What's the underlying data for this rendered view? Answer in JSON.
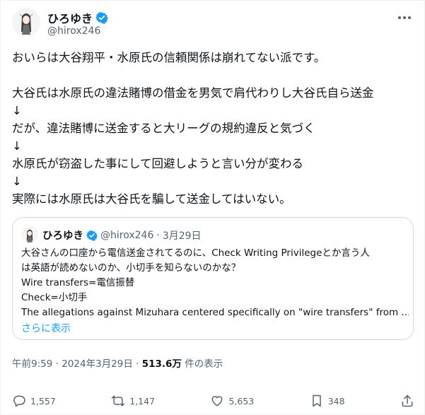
{
  "author": {
    "name": "ひろゆき",
    "handle": "@hirox246"
  },
  "tweet": {
    "lines": [
      "おいらは大谷翔平・水原氏の信頼関係は崩れてない派です。",
      "",
      "大谷氏は水原氏の違法賭博の借金を男気で肩代わりし大谷氏自ら送金",
      "↓",
      "だが、違法賭博に送金すると大リーグの規約違反と気づく",
      "↓",
      "水原氏が窃盗した事にして回避しようと言い分が変わる",
      "↓",
      "実際には水原氏は大谷氏を騙して送金してはいない。"
    ]
  },
  "quote": {
    "name": "ひろゆき",
    "handle": "@hirox246",
    "separator": "·",
    "date": "3月29日",
    "lines": [
      "大谷さんの口座から電信送金されてるのに、Check Writing Privilegeとか言う人",
      "は英語が読めないのか、小切手を知らないのかな？",
      "Wire transfers=電信振替",
      "Check=小切手",
      "The allegations against Mizuhara centered specifically on \"wire transfers\" from ..."
    ],
    "show_more": "さらに表示"
  },
  "meta": {
    "time": "午前9:59",
    "sep1": "·",
    "date": "2024年3月29日",
    "sep2": "·",
    "views": "513.6万",
    "views_label": "件の表示"
  },
  "actions": {
    "replies": "1,557",
    "reposts": "1,147",
    "likes": "5,653",
    "bookmarks": "348"
  },
  "colors": {
    "accent": "#1d9bf0",
    "muted": "#536471",
    "text": "#0f1419",
    "border": "#cfd9de"
  }
}
